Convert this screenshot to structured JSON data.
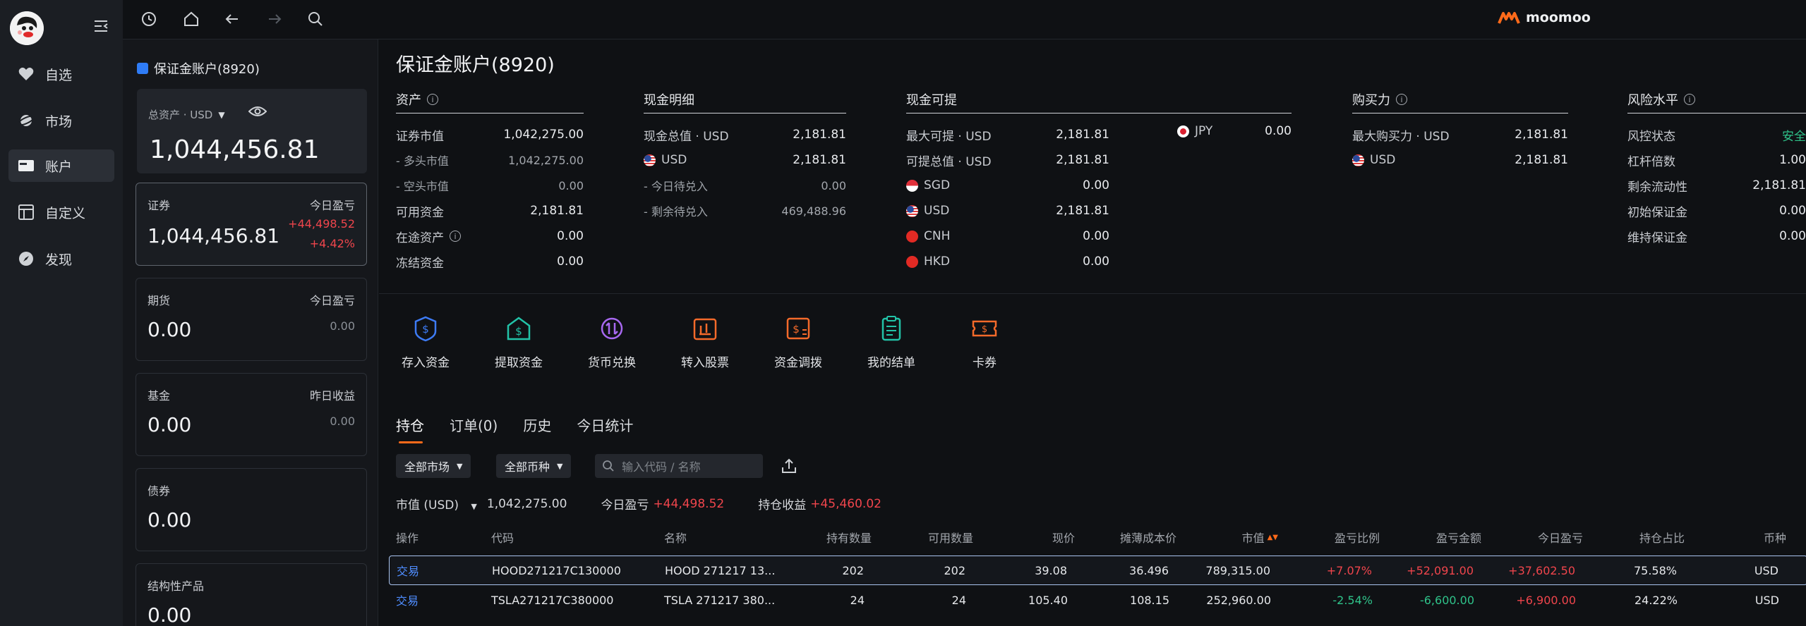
{
  "nav": {
    "items": [
      {
        "label": "自选",
        "icon": "heart-icon"
      },
      {
        "label": "市场",
        "icon": "planet-icon"
      },
      {
        "label": "账户",
        "icon": "wallet-icon"
      },
      {
        "label": "自定义",
        "icon": "layout-icon"
      },
      {
        "label": "发现",
        "icon": "compass-icon"
      }
    ]
  },
  "brand": {
    "name": "moomoo"
  },
  "account": {
    "header": "保证金账户(8920)",
    "total_label": "总资产 · USD",
    "total_value": "1,044,456.81",
    "cards": [
      {
        "label": "证券",
        "right_label": "今日盈亏",
        "value": "1,044,456.81",
        "right_value_1": "+44,498.52",
        "right_value_2": "+4.42%"
      },
      {
        "label": "期货",
        "right_label": "今日盈亏",
        "value": "0.00",
        "right_value_1": "0.00"
      },
      {
        "label": "基金",
        "right_label": "昨日收益",
        "value": "0.00",
        "right_value_1": "0.00"
      },
      {
        "label": "债券",
        "value": "0.00"
      },
      {
        "label": "结构性产品",
        "value": "0.00"
      }
    ]
  },
  "main": {
    "title": "保证金账户(8920)",
    "assets": {
      "title": "资产",
      "rows": [
        {
          "k": "证券市值",
          "v": "1,042,275.00"
        },
        {
          "k": "- 多头市值",
          "v": "1,042,275.00"
        },
        {
          "k": "- 空头市值",
          "v": "0.00"
        },
        {
          "k": "可用资金",
          "v": "2,181.81"
        },
        {
          "k": "在途资产",
          "v": "0.00"
        },
        {
          "k": "冻结资金",
          "v": "0.00"
        }
      ]
    },
    "cash": {
      "title": "现金明细",
      "rows": [
        {
          "k": "现金总值 · USD",
          "v": "2,181.81"
        },
        {
          "k": "USD",
          "v": "2,181.81"
        },
        {
          "k": "- 今日待兑入",
          "v": "0.00"
        },
        {
          "k": "- 剩余待兑入",
          "v": "469,488.96"
        }
      ]
    },
    "withdrawable": {
      "title": "现金可提",
      "rows": [
        {
          "k": "最大可提 · USD",
          "v": "2,181.81"
        },
        {
          "k": "可提总值 · USD",
          "v": "2,181.81"
        },
        {
          "k": "SGD",
          "v": "0.00"
        },
        {
          "k": "USD",
          "v": "2,181.81"
        },
        {
          "k": "CNH",
          "v": "0.00"
        },
        {
          "k": "HKD",
          "v": "0.00"
        }
      ],
      "jpy": {
        "k": "JPY",
        "v": "0.00"
      }
    },
    "buying_power": {
      "title": "购买力",
      "rows": [
        {
          "k": "最大购买力 · USD",
          "v": "2,181.81"
        },
        {
          "k": "USD",
          "v": "2,181.81"
        }
      ]
    },
    "risk": {
      "title": "风险水平",
      "rows": [
        {
          "k": "风控状态",
          "v": "安全"
        },
        {
          "k": "杠杆倍数",
          "v": "1.00"
        },
        {
          "k": "剩余流动性",
          "v": "2,181.81"
        },
        {
          "k": "初始保证金",
          "v": "0.00"
        },
        {
          "k": "维持保证金",
          "v": "0.00"
        }
      ]
    },
    "actions": [
      {
        "label": "存入资金",
        "icon": "deposit-icon",
        "color": "#3d7bf5"
      },
      {
        "label": "提取资金",
        "icon": "withdraw-icon",
        "color": "#22c3a8"
      },
      {
        "label": "货币兑换",
        "icon": "exchange-icon",
        "color": "#a768f0"
      },
      {
        "label": "转入股票",
        "icon": "transfer-stock-icon",
        "color": "#f46a2a"
      },
      {
        "label": "资金调拨",
        "icon": "fund-transfer-icon",
        "color": "#f46a2a"
      },
      {
        "label": "我的结单",
        "icon": "statement-icon",
        "color": "#22c3a8"
      },
      {
        "label": "卡券",
        "icon": "coupon-icon",
        "color": "#f46a2a"
      }
    ],
    "tabs": [
      "持仓",
      "订单(0)",
      "历史",
      "今日统计"
    ],
    "filters": {
      "market": "全部市场",
      "type": "全部币种",
      "search_placeholder": "输入代码 / 名称"
    },
    "summary": {
      "mv_label": "市值 (USD)",
      "mv_value": "1,042,275.00",
      "pl_label": "今日盈亏",
      "pl_value": "+44,498.52",
      "pos_label": "持仓收益",
      "pos_value": "+45,460.02"
    },
    "table": {
      "headers": [
        "操作",
        "代码",
        "名称",
        "持有数量",
        "可用数量",
        "现价",
        "摊薄成本价",
        "市值",
        "盈亏比例",
        "盈亏金额",
        "今日盈亏",
        "持仓占比",
        "币种"
      ],
      "rows": [
        [
          "交易",
          "HOOD271217C130000",
          "HOOD 271217 13...",
          "202",
          "202",
          "39.08",
          "36.496",
          "789,315.00",
          "+7.07%",
          "+52,091.00",
          "+37,602.50",
          "75.58%",
          "USD"
        ],
        [
          "交易",
          "TSLA271217C380000",
          "TSLA 271217 380...",
          "24",
          "24",
          "105.40",
          "108.15",
          "252,960.00",
          "-2.54%",
          "-6,600.00",
          "+6,900.00",
          "24.22%",
          "USD"
        ]
      ]
    }
  }
}
